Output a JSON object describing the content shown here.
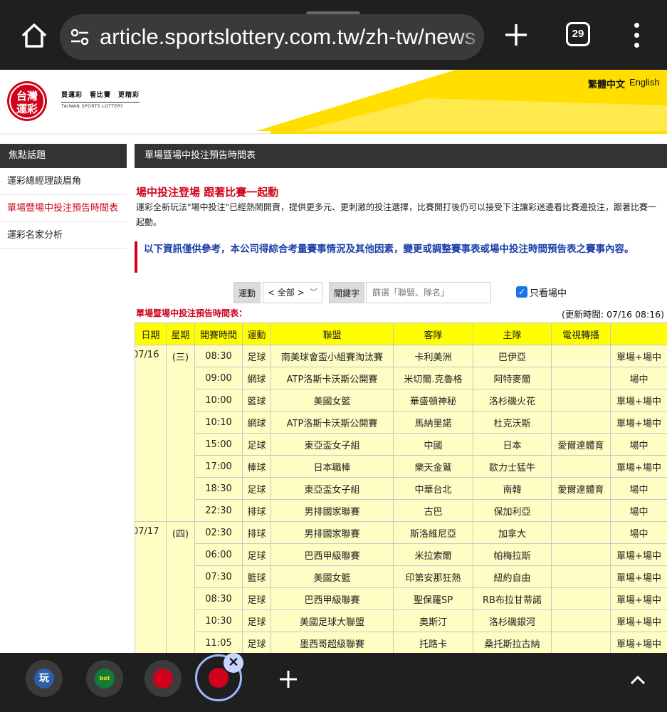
{
  "browser": {
    "url": "article.sportslottery.com.tw/zh-tw/news",
    "tab_count": "29"
  },
  "site": {
    "logo_text": "台灣運彩",
    "logo_slogan": "買運彩　看比賽　更精彩",
    "logo_en": "TAIWAN SPORTS LOTTERY",
    "lang_zh": "繁體中文",
    "lang_en": "English",
    "brand_red": "#d0021b",
    "brand_yellow": "#ffde00"
  },
  "sidebar": {
    "title": "焦點話題",
    "items": [
      {
        "label": "運彩總經理談眉角"
      },
      {
        "label": "單場暨場中投注預告時間表"
      },
      {
        "label": "運彩名家分析"
      }
    ]
  },
  "main": {
    "title": "單場暨場中投注預告時間表",
    "headline": "場中投注登場 跟著比賽一起動",
    "intro": "運彩全新玩法\"場中投注\"已經熱鬧開賣，提供更多元、更刺激的投注選擇，比賽開打後仍可以接受下注讓彩迷邊看比賽邊投注，跟著比賽一起動。",
    "notice": "以下資訊僅供參考，本公司得綜合考量賽事情況及其他因素，變更或調整賽事表或場中投注時間預告表之賽事內容。"
  },
  "filters": {
    "sport_label": "運動",
    "sport_value": "< 全部 >",
    "keyword_label": "關鍵字",
    "keyword_placeholder": "篩選「聯盟、隊名」",
    "only_live_label": "只看場中"
  },
  "table": {
    "caption": "單場暨場中投注預告時間表：",
    "updated": "(更新時間: 07/16 08:16)",
    "headers": [
      "日期",
      "星期",
      "開賽時間",
      "運動",
      "聯盟",
      "客隊",
      "主隊",
      "電視轉播",
      ""
    ],
    "groups": [
      {
        "date": "07/16",
        "weekday": "(三)",
        "rows": [
          {
            "time": "08:30",
            "sport": "足球",
            "league": "南美球會盃小組賽淘汰賽",
            "away": "卡利美洲",
            "home": "巴伊亞",
            "tv": "",
            "type": "單場+場中"
          },
          {
            "time": "09:00",
            "sport": "網球",
            "league": "ATP洛斯卡沃斯公開賽",
            "away": "米切爾.克魯格",
            "home": "阿特麥爾",
            "tv": "",
            "type": "場中"
          },
          {
            "time": "10:00",
            "sport": "籃球",
            "league": "美國女籃",
            "away": "華盛頓神秘",
            "home": "洛杉磯火花",
            "tv": "",
            "type": "單場+場中"
          },
          {
            "time": "10:10",
            "sport": "網球",
            "league": "ATP洛斯卡沃斯公開賽",
            "away": "馬納里諾",
            "home": "杜克沃斯",
            "tv": "",
            "type": "單場+場中"
          },
          {
            "time": "15:00",
            "sport": "足球",
            "league": "東亞盃女子組",
            "away": "中國",
            "home": "日本",
            "tv": "愛爾達體育",
            "type": "場中"
          },
          {
            "time": "17:00",
            "sport": "棒球",
            "league": "日本職棒",
            "away": "樂天金鷲",
            "home": "歐力士猛牛",
            "tv": "",
            "type": "單場+場中"
          },
          {
            "time": "18:30",
            "sport": "足球",
            "league": "東亞盃女子組",
            "away": "中華台北",
            "home": "南韓",
            "tv": "愛爾達體育",
            "type": "場中"
          },
          {
            "time": "22:30",
            "sport": "排球",
            "league": "男排國家聯賽",
            "away": "古巴",
            "home": "保加利亞",
            "tv": "",
            "type": "場中"
          }
        ]
      },
      {
        "date": "07/17",
        "weekday": "(四)",
        "rows": [
          {
            "time": "02:30",
            "sport": "排球",
            "league": "男排國家聯賽",
            "away": "斯洛維尼亞",
            "home": "加拿大",
            "tv": "",
            "type": "場中"
          },
          {
            "time": "06:00",
            "sport": "足球",
            "league": "巴西甲級聯賽",
            "away": "米拉索爾",
            "home": "帕梅拉斯",
            "tv": "",
            "type": "單場+場中"
          },
          {
            "time": "07:30",
            "sport": "籃球",
            "league": "美國女籃",
            "away": "印第安那狂熱",
            "home": "紐約自由",
            "tv": "",
            "type": "單場+場中"
          },
          {
            "time": "08:30",
            "sport": "足球",
            "league": "巴西甲級聯賽",
            "away": "聖保羅SP",
            "home": "RB布拉甘蒂諾",
            "tv": "",
            "type": "單場+場中"
          },
          {
            "time": "10:30",
            "sport": "足球",
            "league": "美國足球大聯盟",
            "away": "奧斯汀",
            "home": "洛杉磯銀河",
            "tv": "",
            "type": "單場+場中"
          },
          {
            "time": "11:05",
            "sport": "足球",
            "league": "墨西哥超級聯賽",
            "away": "托路卡",
            "home": "桑托斯拉古納",
            "tv": "",
            "type": "單場+場中"
          }
        ]
      }
    ]
  },
  "bottom_tabs": [
    {
      "icon": "game-app-icon",
      "color": "#2d5fa8"
    },
    {
      "icon": "bet365-icon",
      "color": "#127a3a"
    },
    {
      "icon": "sports-lottery-icon",
      "color": "#d0021b"
    },
    {
      "icon": "sports-lottery-icon",
      "color": "#d0021b"
    }
  ]
}
